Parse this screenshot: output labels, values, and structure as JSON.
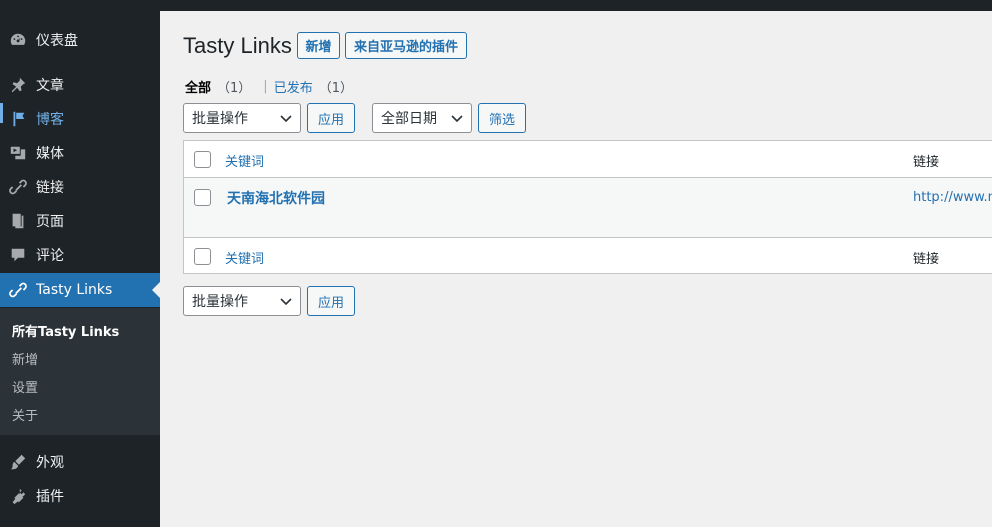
{
  "sidebar": {
    "items": [
      {
        "label": "仪表盘",
        "icon": "dashboard-icon"
      },
      {
        "label": "文章",
        "icon": "pin-icon"
      },
      {
        "label": "博客",
        "icon": "flag-icon"
      },
      {
        "label": "媒体",
        "icon": "media-icon"
      },
      {
        "label": "链接",
        "icon": "link-icon"
      },
      {
        "label": "页面",
        "icon": "page-icon"
      },
      {
        "label": "评论",
        "icon": "comment-icon"
      },
      {
        "label": "Tasty Links",
        "icon": "link-icon"
      },
      {
        "label": "外观",
        "icon": "brush-icon"
      },
      {
        "label": "插件",
        "icon": "plugin-icon"
      }
    ],
    "submenu": [
      "所有Tasty Links",
      "新增",
      "设置",
      "关于"
    ]
  },
  "main": {
    "title": "Tasty Links",
    "add_new": "新增",
    "amazon_plugin": "来自亚马逊的插件",
    "filters": {
      "all": "全部",
      "all_count": "（1）",
      "published": "已发布",
      "published_count": "（1）",
      "pipe": "|"
    },
    "bulk_action": "批量操作",
    "apply": "应用",
    "all_dates": "全部日期",
    "filter": "筛选",
    "table": {
      "col_keyword": "关键词",
      "col_link": "链接",
      "rows": [
        {
          "title": "天南海北软件园",
          "url": "http://www.ne"
        }
      ]
    }
  },
  "colors": {
    "sidebar_bg": "#1d2327",
    "accent": "#2271b1",
    "link": "#72aee6"
  }
}
